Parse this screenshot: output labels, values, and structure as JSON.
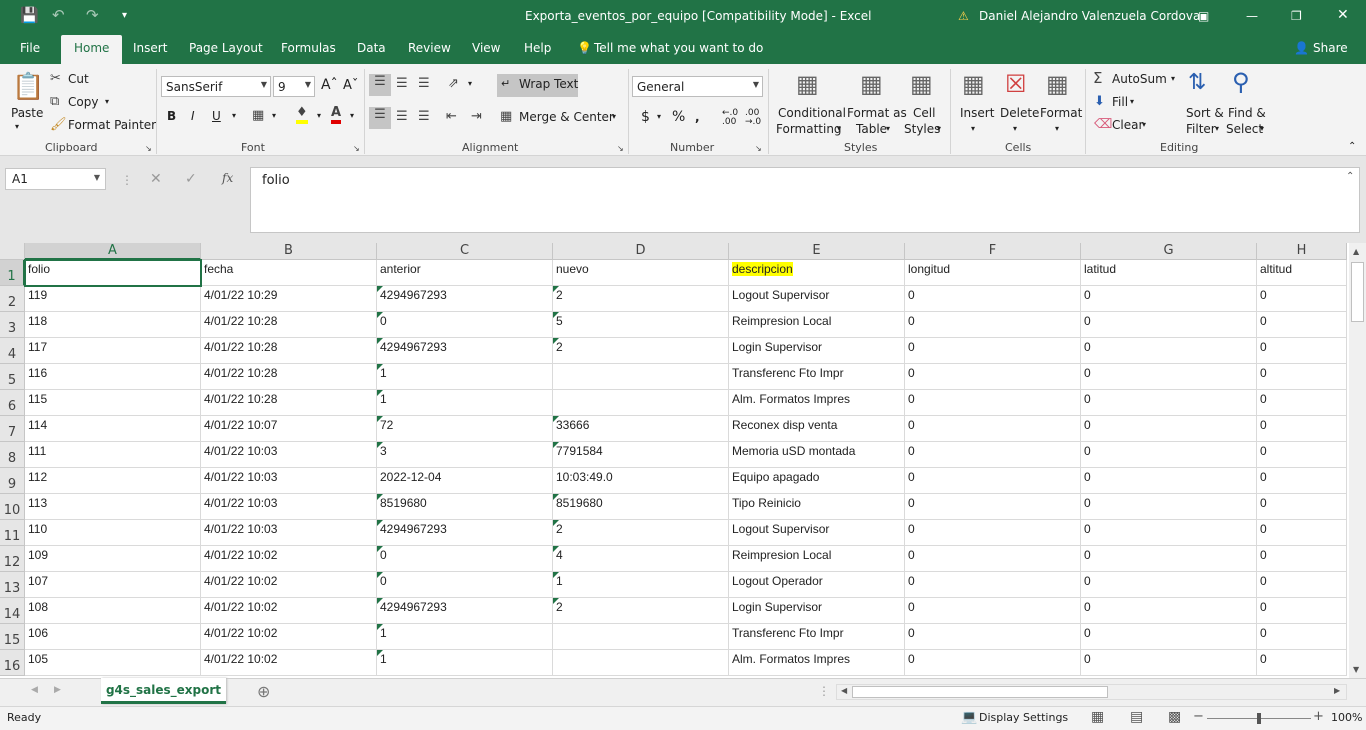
{
  "window": {
    "title": "Exporta_eventos_por_equipo  [Compatibility Mode]  -  Excel",
    "user": "Daniel Alejandro Valenzuela Cordova",
    "accent": "#217346"
  },
  "menu_tabs": [
    "File",
    "Home",
    "Insert",
    "Page Layout",
    "Formulas",
    "Data",
    "Review",
    "View",
    "Help"
  ],
  "tell_me": "Tell me what you want to do",
  "share": "Share",
  "ribbon": {
    "clipboard": {
      "paste": "Paste",
      "cut": "Cut",
      "copy": "Copy",
      "format_painter": "Format Painter",
      "group": "Clipboard"
    },
    "font": {
      "name": "SansSerif",
      "size": "9",
      "bold": "B",
      "italic": "I",
      "underline": "U",
      "group": "Font"
    },
    "alignment": {
      "wrap": "Wrap Text",
      "merge": "Merge & Center",
      "group": "Alignment"
    },
    "number": {
      "format": "General",
      "currency": "$",
      "percent": "%",
      "group": "Number"
    },
    "styles": {
      "conditional1": "Conditional",
      "conditional2": "Formatting",
      "table1": "Format as",
      "table2": "Table",
      "cell1": "Cell",
      "cell2": "Styles",
      "group": "Styles"
    },
    "cells": {
      "insert": "Insert",
      "delete": "Delete",
      "format": "Format",
      "group": "Cells"
    },
    "editing": {
      "autosum": "AutoSum",
      "fill": "Fill",
      "clear": "Clear",
      "sort1": "Sort &",
      "sort2": "Filter",
      "find1": "Find &",
      "find2": "Select",
      "group": "Editing"
    }
  },
  "formula_bar": {
    "name_box": "A1",
    "fx": "fx",
    "content": "folio"
  },
  "columns": [
    "A",
    "B",
    "C",
    "D",
    "E",
    "F",
    "G",
    "H"
  ],
  "header_row": [
    "folio",
    "fecha",
    "anterior",
    "nuevo",
    "descripcion",
    "longitud",
    "latitud",
    "altitud"
  ],
  "rows": [
    {
      "n": "2",
      "c": [
        "119",
        "4/01/22 10:29",
        "4294967293",
        "2",
        "Logout Supervisor",
        "0",
        "0",
        "0"
      ],
      "ind": [
        2,
        3
      ]
    },
    {
      "n": "3",
      "c": [
        "118",
        "4/01/22 10:28",
        "0",
        "5",
        "Reimpresion Local",
        "0",
        "0",
        "0"
      ],
      "ind": [
        2,
        3
      ]
    },
    {
      "n": "4",
      "c": [
        "117",
        "4/01/22 10:28",
        "4294967293",
        "2",
        "Login Supervisor",
        "0",
        "0",
        "0"
      ],
      "ind": [
        2,
        3
      ]
    },
    {
      "n": "5",
      "c": [
        "116",
        "4/01/22 10:28",
        "1",
        "",
        "Transferenc Fto Impr",
        "0",
        "0",
        "0"
      ],
      "ind": [
        2
      ]
    },
    {
      "n": "6",
      "c": [
        "115",
        "4/01/22 10:28",
        "1",
        "",
        "Alm. Formatos Impres",
        "0",
        "0",
        "0"
      ],
      "ind": [
        2
      ]
    },
    {
      "n": "7",
      "c": [
        "114",
        "4/01/22 10:07",
        "72",
        "33666",
        "Reconex disp venta",
        "0",
        "0",
        "0"
      ],
      "ind": [
        2,
        3
      ]
    },
    {
      "n": "8",
      "c": [
        "111",
        "4/01/22 10:03",
        "3",
        "7791584",
        "Memoria uSD montada",
        "0",
        "0",
        "0"
      ],
      "ind": [
        2,
        3
      ]
    },
    {
      "n": "9",
      "c": [
        "112",
        "4/01/22 10:03",
        "2022-12-04",
        "10:03:49.0",
        "Equipo apagado",
        "0",
        "0",
        "0"
      ],
      "ind": []
    },
    {
      "n": "10",
      "c": [
        "113",
        "4/01/22 10:03",
        "8519680",
        "8519680",
        "Tipo Reinicio",
        "0",
        "0",
        "0"
      ],
      "ind": [
        2,
        3
      ]
    },
    {
      "n": "11",
      "c": [
        "110",
        "4/01/22 10:03",
        "4294967293",
        "2",
        "Logout Supervisor",
        "0",
        "0",
        "0"
      ],
      "ind": [
        2,
        3
      ]
    },
    {
      "n": "12",
      "c": [
        "109",
        "4/01/22 10:02",
        "0",
        "4",
        "Reimpresion Local",
        "0",
        "0",
        "0"
      ],
      "ind": [
        2,
        3
      ]
    },
    {
      "n": "13",
      "c": [
        "107",
        "4/01/22 10:02",
        "0",
        "1",
        "Logout Operador",
        "0",
        "0",
        "0"
      ],
      "ind": [
        2,
        3
      ]
    },
    {
      "n": "14",
      "c": [
        "108",
        "4/01/22 10:02",
        "4294967293",
        "2",
        "Login Supervisor",
        "0",
        "0",
        "0"
      ],
      "ind": [
        2,
        3
      ]
    },
    {
      "n": "15",
      "c": [
        "106",
        "4/01/22 10:02",
        "1",
        "",
        "Transferenc Fto Impr",
        "0",
        "0",
        "0"
      ],
      "ind": [
        2
      ]
    },
    {
      "n": "16",
      "c": [
        "105",
        "4/01/22 10:02",
        "1",
        "",
        "Alm. Formatos Impres",
        "0",
        "0",
        "0"
      ],
      "ind": [
        2
      ]
    }
  ],
  "sheet_tab": "g4s_sales_export",
  "status": {
    "ready": "Ready",
    "display_settings": "Display Settings",
    "zoom": "100%"
  }
}
